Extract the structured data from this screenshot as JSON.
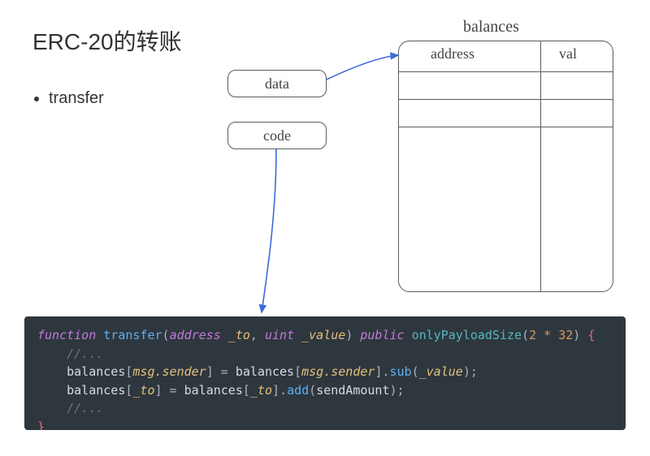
{
  "title": "ERC-20的转账",
  "bullets": [
    "transfer"
  ],
  "sketch": {
    "data_label": "data",
    "code_label": "code",
    "table_caption": "balances",
    "table_headers": {
      "address": "address",
      "val": "val"
    }
  },
  "code": {
    "fn_kw": "function",
    "fn_name": "transfer",
    "param1_type": "address",
    "param1_name": "_to",
    "param2_type": "uint",
    "param2_name": "_value",
    "vis_kw": "public",
    "modifier": "onlyPayloadSize",
    "modifier_arg": "2 * 32",
    "comment1": "//...",
    "line1_lhs_obj": "balances",
    "line1_lhs_key": "msg.sender",
    "line1_rhs_obj": "balances",
    "line1_rhs_key": "msg.sender",
    "line1_method": "sub",
    "line1_arg": "_value",
    "line2_lhs_obj": "balances",
    "line2_lhs_key": "_to",
    "line2_rhs_obj": "balances",
    "line2_rhs_key": "_to",
    "line2_method": "add",
    "line2_arg": "sendAmount",
    "comment2": "//..."
  }
}
